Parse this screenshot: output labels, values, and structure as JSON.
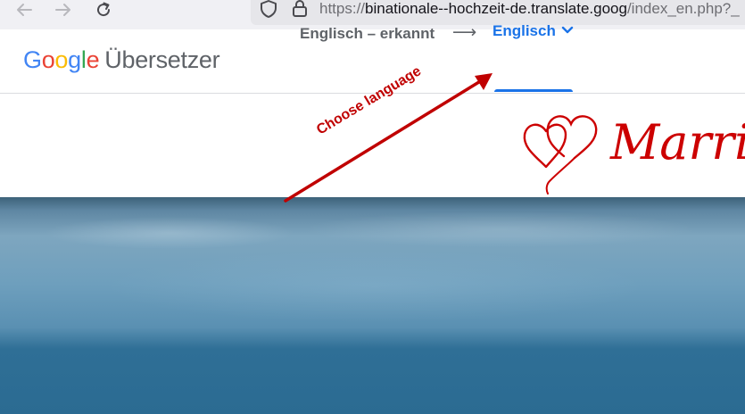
{
  "browser": {
    "url": {
      "scheme": "https://",
      "host": "binationale--hochzeit-de.translate.goog",
      "path": "/index_en.php?_"
    }
  },
  "translate_header": {
    "logo": {
      "letters": [
        "G",
        "o",
        "o",
        "g",
        "l",
        "e"
      ],
      "letter_colors": [
        "#4285f4",
        "#ea4335",
        "#fbbc05",
        "#4285f4",
        "#34a853",
        "#ea4335"
      ],
      "product_name": "Übersetzer"
    },
    "source_language": "Englisch – erkannt",
    "arrow_glyph": "⟶",
    "target_language": "Englisch",
    "accent_color": "#1a73e8"
  },
  "site": {
    "brand_text": "Marri",
    "brand_color": "#cc0000"
  },
  "annotation": {
    "label": "Choose language",
    "color": "#c00000"
  }
}
